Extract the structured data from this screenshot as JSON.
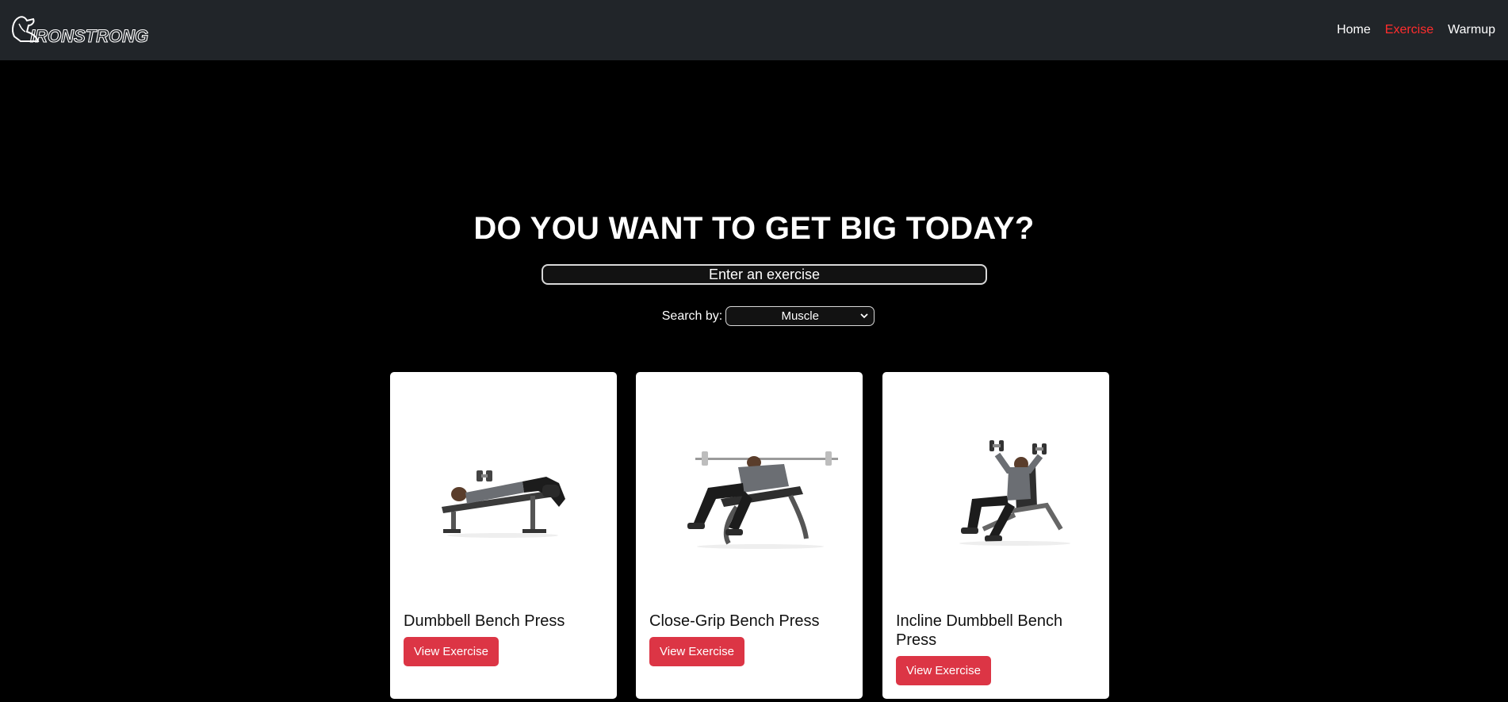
{
  "nav": {
    "brand": "IRONSTRONG",
    "links": [
      {
        "label": "Home",
        "active": false
      },
      {
        "label": "Exercise",
        "active": true
      },
      {
        "label": "Warmup",
        "active": false
      }
    ]
  },
  "hero": {
    "headline": "DO YOU WANT TO GET BIG TODAY?",
    "search_placeholder": "Enter an exercise",
    "search_by_label": "Search by:",
    "search_by_selected": "Muscle"
  },
  "cards": [
    {
      "title": "Dumbbell Bench Press",
      "button": "View Exercise",
      "icon": "dumbbell-bench-press-photo"
    },
    {
      "title": "Close-Grip Bench Press",
      "button": "View Exercise",
      "icon": "close-grip-bench-press-photo"
    },
    {
      "title": "Incline Dumbbell Bench Press",
      "button": "View Exercise",
      "icon": "incline-dumbbell-bench-press-photo"
    }
  ],
  "colors": {
    "navbar_bg": "#212529",
    "page_bg": "#000000",
    "active_link": "#ff2d2d",
    "button_bg": "#dc3545"
  }
}
